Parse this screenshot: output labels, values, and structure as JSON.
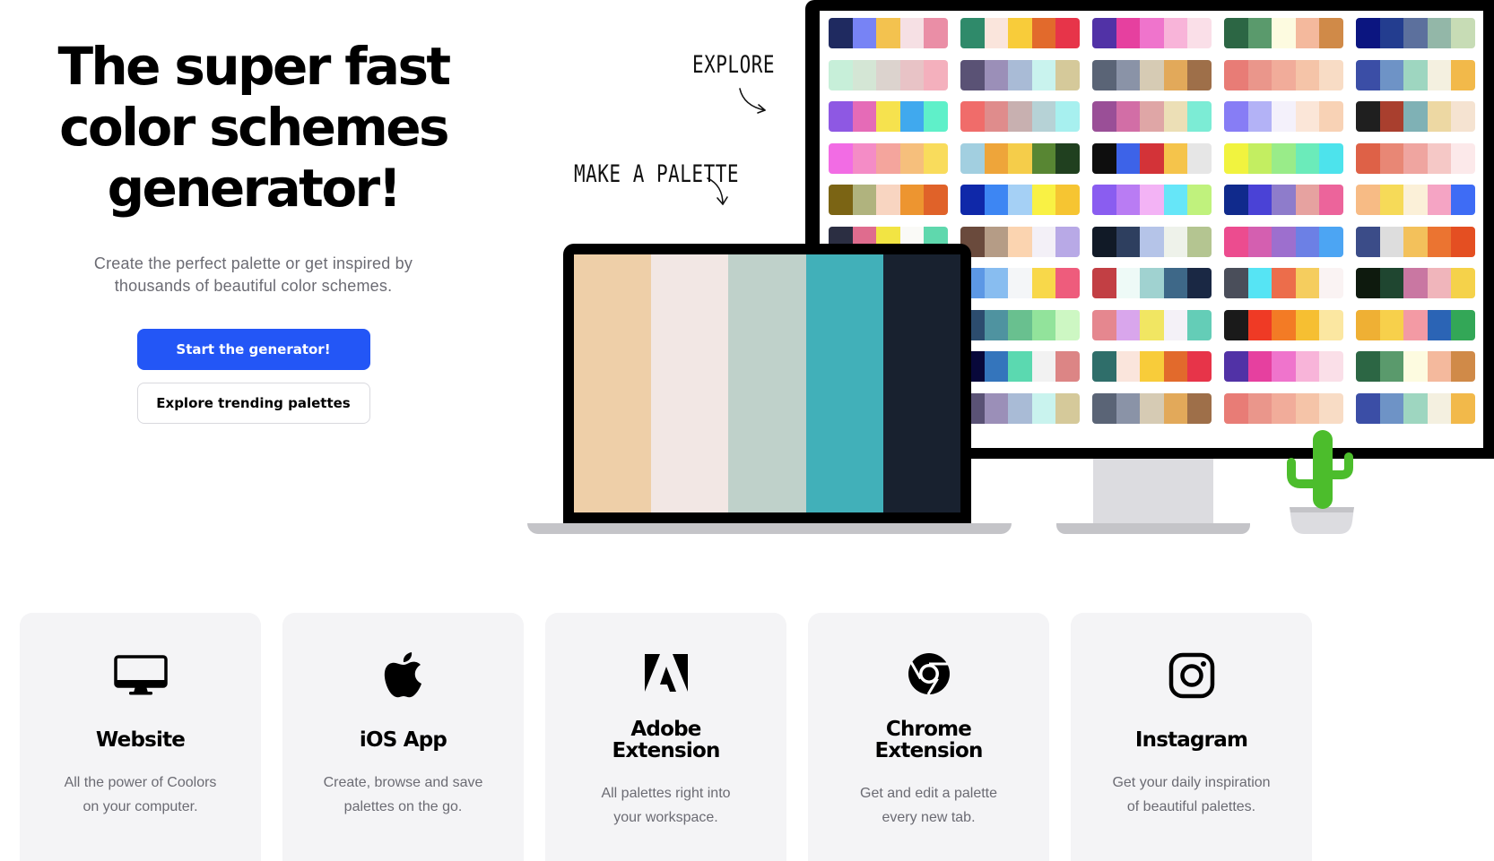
{
  "hero": {
    "title_line1": "The super fast",
    "title_line2": "color schemes",
    "title_line3": "generator!",
    "subtitle_line1": "Create the perfect palette or get inspired by",
    "subtitle_line2": "thousands of beautiful color schemes.",
    "primary_button": "Start the generator!",
    "secondary_button": "Explore trending palettes"
  },
  "illustration": {
    "note_explore": "EXPLORE",
    "note_make_palette": "MAKE A PALETTE",
    "laptop_palette": [
      "#eecfa8",
      "#f2e7e4",
      "#bfd1ca",
      "#41b0b9",
      "#18212f"
    ],
    "monitor_palettes": [
      [
        "#1f2a60",
        "#7783f5",
        "#f3c24f",
        "#f6e0e4",
        "#ea8ea6"
      ],
      [
        "#2f8a6a",
        "#fae5dc",
        "#f8cc3a",
        "#e26a2c",
        "#e73449"
      ],
      [
        "#5132a6",
        "#e6409f",
        "#ef74cc",
        "#f8b4d9",
        "#fadfe8"
      ],
      [
        "#2c6644",
        "#5a9a6c",
        "#fdfbe0",
        "#f4b99d",
        "#d08a48"
      ],
      [
        "#0b1580",
        "#233d8f",
        "#5c709d",
        "#93b7a8",
        "#c7dcb5"
      ],
      [
        "#c7efd9",
        "#d4e6d5",
        "#dcd3ce",
        "#e8c3c6",
        "#f4b0bd"
      ],
      [
        "#5a5275",
        "#9b8fb8",
        "#a9bbd6",
        "#c9f3ee",
        "#d5c99a"
      ],
      [
        "#5a6476",
        "#8a93a7",
        "#d6cbb4",
        "#e2a95a",
        "#9e6f49"
      ],
      [
        "#e87c76",
        "#ea968b",
        "#f1ac9a",
        "#f5c4a8",
        "#f8dcc5"
      ],
      [
        "#3b4ea6",
        "#6e93c6",
        "#9ed6c0",
        "#f4f0e0",
        "#f2b94a"
      ],
      [
        "#8e58e3",
        "#e56bb7",
        "#f6e24e",
        "#40a9ee",
        "#5ff0c9"
      ],
      [
        "#f06c6a",
        "#df8c8c",
        "#c8b0b0",
        "#b6d2d6",
        "#a7f0ef"
      ],
      [
        "#9a4f97",
        "#d26ea6",
        "#dfa6a6",
        "#ecdfb6",
        "#7cecd5"
      ],
      [
        "#877df5",
        "#b3b2f6",
        "#f4f1fb",
        "#fbe6d8",
        "#f8d2b5"
      ],
      [
        "#1f1f1f",
        "#a93f2e",
        "#7fb1b5",
        "#edd8a3",
        "#f5e3d1"
      ],
      [
        "#f26ce4",
        "#f48cc6",
        "#f4a59d",
        "#f6bf7c",
        "#f9dc5c"
      ],
      [
        "#a2cfe0",
        "#eea53a",
        "#f5cd4a",
        "#588633",
        "#20401f"
      ],
      [
        "#0e0e0e",
        "#3d63e8",
        "#d33338",
        "#f5c44b",
        "#e6e6e6"
      ],
      [
        "#f1f33f",
        "#c3ee61",
        "#99ec89",
        "#6bebba",
        "#4de3ec"
      ],
      [
        "#de6147",
        "#e88775",
        "#efa5a0",
        "#f5c8c6",
        "#fce9ea"
      ],
      [
        "#7b6414",
        "#b0b37e",
        "#f8d5c1",
        "#ed9530",
        "#e06229"
      ],
      [
        "#0f28a9",
        "#3d86f3",
        "#a5d0f5",
        "#f9f144",
        "#f6c532"
      ],
      [
        "#8a5df0",
        "#b97cf3",
        "#f3b3f5",
        "#66e6f8",
        "#c0f27d"
      ],
      [
        "#102a8c",
        "#4a42d6",
        "#8e7ccb",
        "#e6a2a0",
        "#ec649b"
      ],
      [
        "#f7bb85",
        "#f6da58",
        "#fbf0d8",
        "#f5a4c4",
        "#3e6cf5"
      ],
      [
        "#2b2e42",
        "#df6c8e",
        "#f2e443",
        "#fafaf7",
        "#5fd8ad"
      ],
      [
        "#6a4a3c",
        "#b59c86",
        "#fbd4b0",
        "#f3f0f7",
        "#b8a9e6"
      ],
      [
        "#111a27",
        "#2e3f5f",
        "#b5c4e8",
        "#eef2ea",
        "#b4c591"
      ],
      [
        "#ec4c8f",
        "#d45fb0",
        "#9d6fce",
        "#6c80e5",
        "#4ca5f3"
      ],
      [
        "#3b4c88",
        "#dddddd",
        "#f3c15b",
        "#eb7431",
        "#e44f22"
      ],
      [
        "#1b3e5f",
        "#548faf",
        "#8ab6c4",
        "#e5e2da",
        "#f1a23c"
      ],
      [
        "#5c98e5",
        "#88bdf0",
        "#f4f6f8",
        "#f8d84a",
        "#ee5c7c"
      ],
      [
        "#c23f44",
        "#eefaf7",
        "#a0d2d0",
        "#3e6888",
        "#1a2844"
      ],
      [
        "#4a4e5a",
        "#56e4f4",
        "#ec6d4b",
        "#f5cd5e",
        "#faf3f3"
      ],
      [
        "#0e1a0e",
        "#1f4630",
        "#c977a2",
        "#f0b5bb",
        "#f5d24a"
      ],
      [
        "#3c3633",
        "#807873",
        "#b5ada6",
        "#eceaea",
        "#d6a39a"
      ],
      [
        "#2c4c6e",
        "#4f93a0",
        "#69c08f",
        "#92e39b",
        "#cdf7c3"
      ],
      [
        "#e5878f",
        "#d9a6ec",
        "#f1e662",
        "#f4f1f7",
        "#64cdb7"
      ],
      [
        "#1a1a1a",
        "#ef3a25",
        "#f37b25",
        "#f6bf32",
        "#fbe7a1"
      ],
      [
        "#efb034",
        "#f7d04b",
        "#f39aa4",
        "#2b64b5",
        "#33a757"
      ],
      [
        "#6b5d5e",
        "#e87070",
        "#f3a69a",
        "#a8d4f5",
        "#5e79f2"
      ],
      [
        "#08083a",
        "#3475bc",
        "#5bd9b0",
        "#f2f2f2",
        "#dc8585"
      ],
      [
        "#2f6e6a",
        "#fae5dc",
        "#f8cc3a",
        "#e26a2c",
        "#e73449"
      ],
      [
        "#5132a6",
        "#e6409f",
        "#ef74cc",
        "#f8b4d9",
        "#fadfe8"
      ],
      [
        "#2c6644",
        "#5a9a6c",
        "#fdfbe0",
        "#f4b99d",
        "#d08a48"
      ],
      [
        "#0b1580",
        "#233d8f",
        "#5c709d",
        "#93b7a8",
        "#c7dcb5"
      ],
      [
        "#5a5275",
        "#9b8fb8",
        "#a9bbd6",
        "#c9f3ee",
        "#d5c99a"
      ],
      [
        "#5a6476",
        "#8a93a7",
        "#d6cbb4",
        "#e2a95a",
        "#9e6f49"
      ],
      [
        "#e87c76",
        "#ea968b",
        "#f1ac9a",
        "#f5c4a8",
        "#f8dcc5"
      ],
      [
        "#3b4ea6",
        "#6e93c6",
        "#9ed6c0",
        "#f4f0e0",
        "#f2b94a"
      ]
    ]
  },
  "cards": [
    {
      "title": "Website",
      "desc_line1": "All the power of Coolors",
      "desc_line2": "on your computer."
    },
    {
      "title": "iOS App",
      "desc_line1": "Create, browse and save",
      "desc_line2": "palettes on the go."
    },
    {
      "title_line1": "Adobe",
      "title_line2": "Extension",
      "desc_line1": "All palettes right into",
      "desc_line2": "your workspace."
    },
    {
      "title_line1": "Chrome",
      "title_line2": "Extension",
      "desc_line1": "Get and edit a palette",
      "desc_line2": "every new tab."
    },
    {
      "title": "Instagram",
      "desc_line1": "Get your daily inspiration",
      "desc_line2": "of beautiful palettes."
    }
  ],
  "colors": {
    "primary": "#2356f6",
    "card_bg": "#f4f4f6",
    "cactus": "#4cbd2c"
  }
}
